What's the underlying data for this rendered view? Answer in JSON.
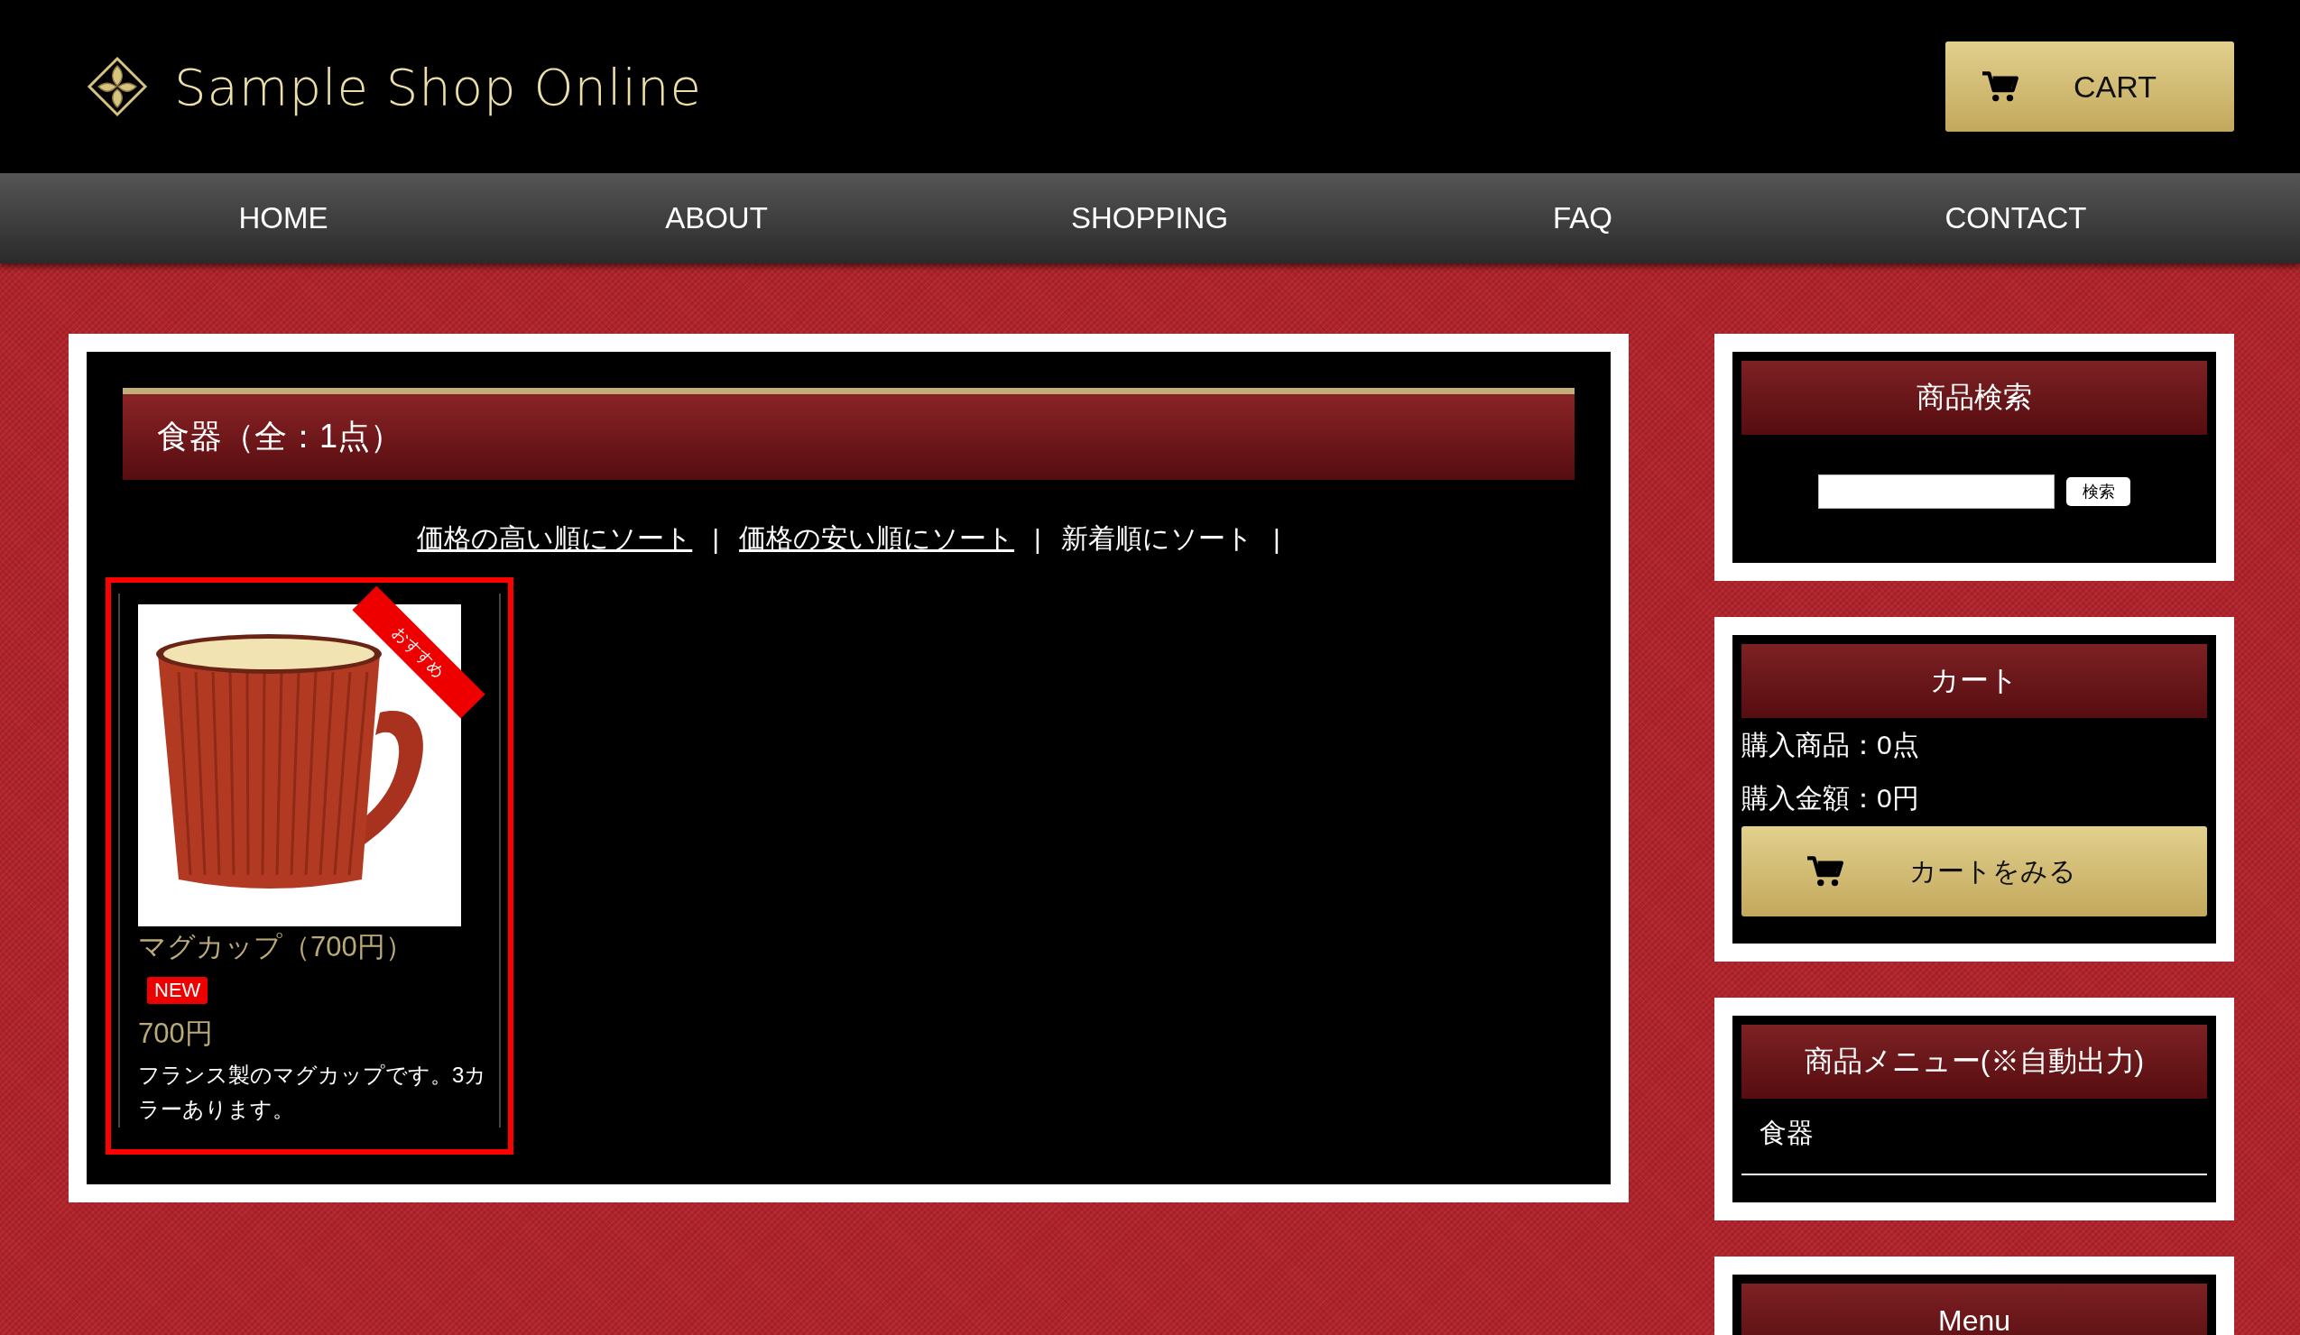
{
  "header": {
    "logo": "Sample Shop Online",
    "cart_button": "CART"
  },
  "nav": [
    {
      "label": "HOME"
    },
    {
      "label": "ABOUT"
    },
    {
      "label": "SHOPPING"
    },
    {
      "label": "FAQ"
    },
    {
      "label": "CONTACT"
    }
  ],
  "category": {
    "title": "食器（全：1点）",
    "sort_links": [
      {
        "label": "価格の高い順にソート",
        "link": true,
        "separator": "|"
      },
      {
        "label": "価格の安い順にソート",
        "link": true,
        "separator": "|"
      },
      {
        "label": "新着順にソート",
        "link": false,
        "separator": "|"
      }
    ],
    "products": [
      {
        "ribbon": "おすすめ",
        "name": "マグカップ（700円）",
        "badge": "NEW",
        "price": "700円",
        "description": "フランス製のマグカップです。3カラーあります。"
      }
    ]
  },
  "sidebar": [
    {
      "kind": "search",
      "title": "商品検索",
      "button": "検索"
    },
    {
      "kind": "cart",
      "title": "カート",
      "lines": [
        "購入商品：0点",
        "購入金額：0円"
      ],
      "button": "カートをみる"
    },
    {
      "kind": "menu",
      "title": "商品メニュー(※自動出力)",
      "items": [
        "食器"
      ]
    },
    {
      "kind": "menu",
      "title": "Menu"
    }
  ]
}
